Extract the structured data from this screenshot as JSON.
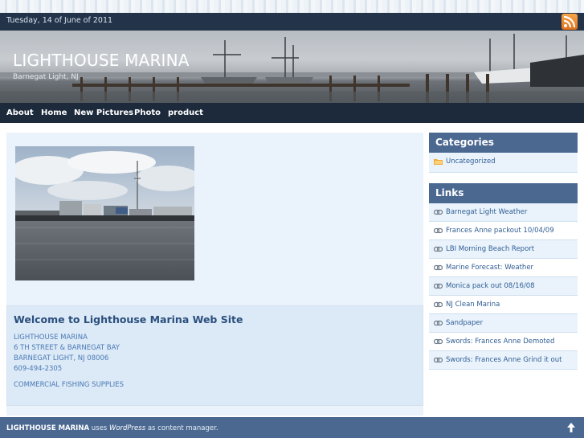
{
  "header": {
    "date": "Tuesday, 14 of June of 2011",
    "site_title": "LIGHTHOUSE MARINA",
    "tagline": "Barnegat Light, NJ",
    "rss_icon": "rss-icon"
  },
  "nav": {
    "items": [
      "About",
      "Home",
      "New Pictures",
      "Photo",
      "product"
    ]
  },
  "post": {
    "title": "Welcome to Lighthouse Marina Web Site",
    "address": [
      "LIGHTHOUSE MARINA",
      "6 TH STREET & BARNEGAT BAY",
      "BARNEGAT LIGHT, NJ 08006",
      "609-494-2305"
    ],
    "tagline": "COMMERCIAL FISHING SUPPLIES"
  },
  "sidebar": {
    "categories_title": "Categories",
    "categories": [
      "Uncategorized"
    ],
    "links_title": "Links",
    "links": [
      "Barnegat Light Weather",
      "Frances Anne packout 10/04/09",
      "LBI Morning Beach Report",
      "Marine Forecast: Weather",
      "Monica pack out 08/16/08",
      "NJ Clean Marina",
      "Sandpaper",
      "Swords: Frances Anne Demoted",
      "Swords: Frances Anne Grind it out"
    ]
  },
  "footer": {
    "site_name": "LIGHTHOUSE MARINA",
    "text_before": " uses ",
    "cms": "WordPress",
    "text_after": " as content manager."
  },
  "colors": {
    "header_bg": "#1c2a3c",
    "widget_title_bg": "#4b6891",
    "link_color": "#2f5d93",
    "content_bg": "#eaf3fc"
  }
}
